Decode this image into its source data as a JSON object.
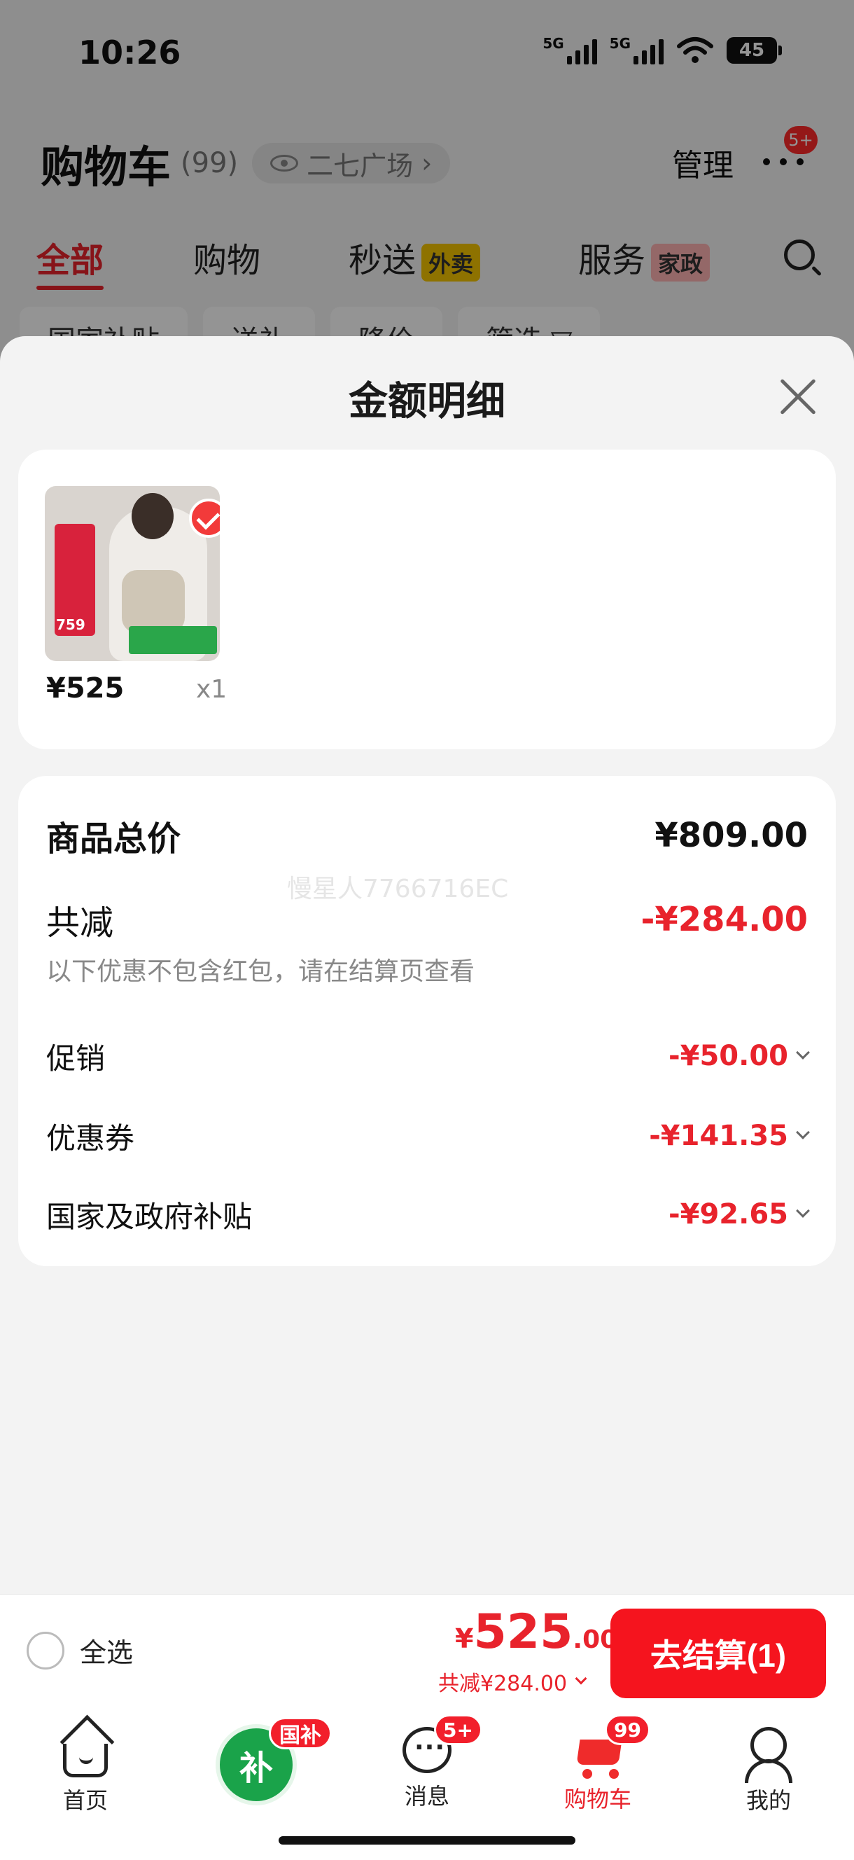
{
  "status_bar": {
    "time": "10:26",
    "net1": "5G",
    "net2": "5G",
    "battery": "45"
  },
  "cart_header": {
    "title": "购物车",
    "count": "(99)",
    "location": "二七广场",
    "manage": "管理",
    "more_badge": "5+"
  },
  "tabs": [
    {
      "label": "全部"
    },
    {
      "label": "购物"
    },
    {
      "label": "秒送",
      "tag": "外卖"
    },
    {
      "label": "服务",
      "tag": "家政"
    }
  ],
  "filters": [
    "国家补贴",
    "送礼",
    "降价",
    "筛选 ▽"
  ],
  "sheet": {
    "title": "金额明细",
    "product": {
      "price": "¥525",
      "qty": "x1",
      "thumb_price": "759"
    },
    "summary": {
      "total_label": "商品总价",
      "total_value": "¥809.00",
      "reduce_label": "共减",
      "reduce_value": "-¥284.00",
      "note": "以下优惠不包含红包，请在结算页查看",
      "items": [
        {
          "label": "促销",
          "value": "-¥50.00"
        },
        {
          "label": "优惠券",
          "value": "-¥141.35"
        },
        {
          "label": "国家及政府补贴",
          "value": "-¥92.65"
        }
      ],
      "watermark": "慢星人7766716EC"
    }
  },
  "checkout": {
    "select_all": "全选",
    "currency": "¥",
    "total_int": "525",
    "total_dec": ".00",
    "reduce_text": "共减¥284.00",
    "button": "去结算(1)"
  },
  "bottom_nav": {
    "home": "首页",
    "gov_tag": "国补",
    "gov_icon_text": "补",
    "messages": "消息",
    "messages_badge": "5+",
    "cart": "购物车",
    "cart_badge": "99",
    "me": "我的"
  },
  "colors": {
    "accent": "#e8232c",
    "button": "#f5141e",
    "gov_green": "#1aa34a"
  }
}
